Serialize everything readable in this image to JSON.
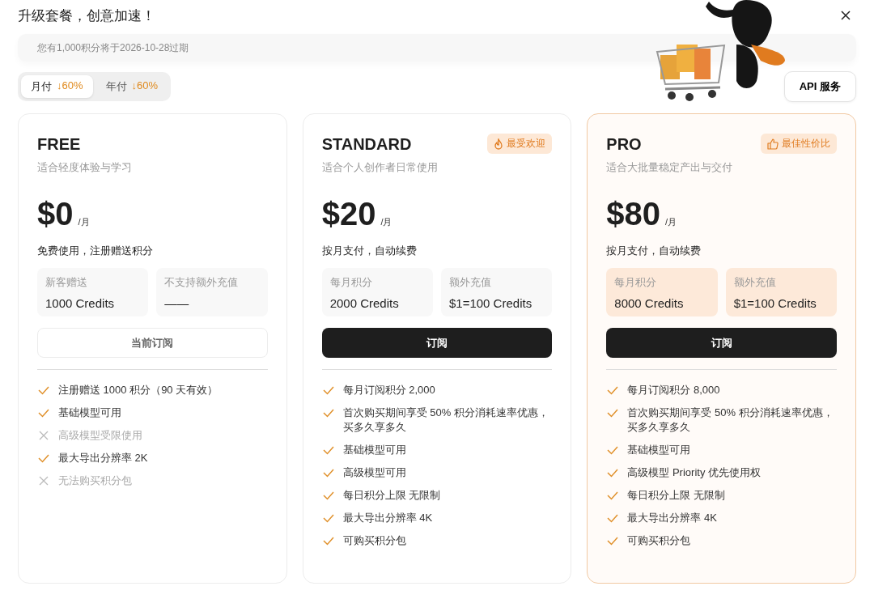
{
  "title": "升级套餐，创意加速！",
  "banner": {
    "text": "您有1,000积分将于2026-10-28过期"
  },
  "billing_tabs": [
    {
      "label": "月付",
      "discount": "↓60%",
      "selected": true
    },
    {
      "label": "年付",
      "discount": "↓60%",
      "selected": false
    }
  ],
  "api_button": "API 服务",
  "plans": [
    {
      "name": "FREE",
      "subtitle": "适合轻度体验与学习",
      "price": "$0",
      "period": "/月",
      "payment_note": "免费使用，注册赠送积分",
      "highlighted": false,
      "credit_boxes": [
        {
          "label": "新客赠送",
          "value": "1000 Credits"
        },
        {
          "label": "不支持额外充值",
          "value": "——"
        }
      ],
      "button": {
        "label": "当前订阅",
        "kind": "current"
      },
      "features": [
        {
          "text": "注册赠送 1000 积分（90 天有效）",
          "included": true
        },
        {
          "text": "基础模型可用",
          "included": true
        },
        {
          "text": "高级模型受限使用",
          "included": false
        },
        {
          "text": "最大导出分辨率 2K",
          "included": true
        },
        {
          "text": "无法购买积分包",
          "included": false
        }
      ]
    },
    {
      "name": "STANDARD",
      "subtitle": "适合个人创作者日常使用",
      "badge": {
        "kind": "fire",
        "label": "最受欢迎"
      },
      "price": "$20",
      "period": "/月",
      "payment_note": "按月支付，自动续费",
      "highlighted": false,
      "credit_boxes": [
        {
          "label": "每月积分",
          "value": "2000 Credits"
        },
        {
          "label": "额外充值",
          "value": "$1=100 Credits"
        }
      ],
      "button": {
        "label": "订阅",
        "kind": "subscribe"
      },
      "features": [
        {
          "text": "每月订阅积分 2,000",
          "included": true
        },
        {
          "text": "首次购买期间享受 50% 积分消耗速率优惠，买多久享多久",
          "included": true
        },
        {
          "text": "基础模型可用",
          "included": true
        },
        {
          "text": "高级模型可用",
          "included": true
        },
        {
          "text": "每日积分上限 无限制",
          "included": true
        },
        {
          "text": "最大导出分辨率 4K",
          "included": true
        },
        {
          "text": "可购买积分包",
          "included": true
        }
      ]
    },
    {
      "name": "PRO",
      "subtitle": "适合大批量稳定产出与交付",
      "badge": {
        "kind": "thumb",
        "label": "最佳性价比"
      },
      "price": "$80",
      "period": "/月",
      "payment_note": "按月支付，自动续费",
      "highlighted": true,
      "credit_boxes": [
        {
          "label": "每月积分",
          "value": "8000 Credits"
        },
        {
          "label": "额外充值",
          "value": "$1=100 Credits"
        }
      ],
      "button": {
        "label": "订阅",
        "kind": "subscribe"
      },
      "features": [
        {
          "text": "每月订阅积分 8,000",
          "included": true
        },
        {
          "text": "首次购买期间享受 50% 积分消耗速率优惠，买多久享多久",
          "included": true
        },
        {
          "text": "基础模型可用",
          "included": true
        },
        {
          "text": "高级模型 Priority 优先使用权",
          "included": true
        },
        {
          "text": "每日积分上限 无限制",
          "included": true
        },
        {
          "text": "最大导出分辨率 4K",
          "included": true
        },
        {
          "text": "可购买积分包",
          "included": true
        }
      ]
    }
  ]
}
